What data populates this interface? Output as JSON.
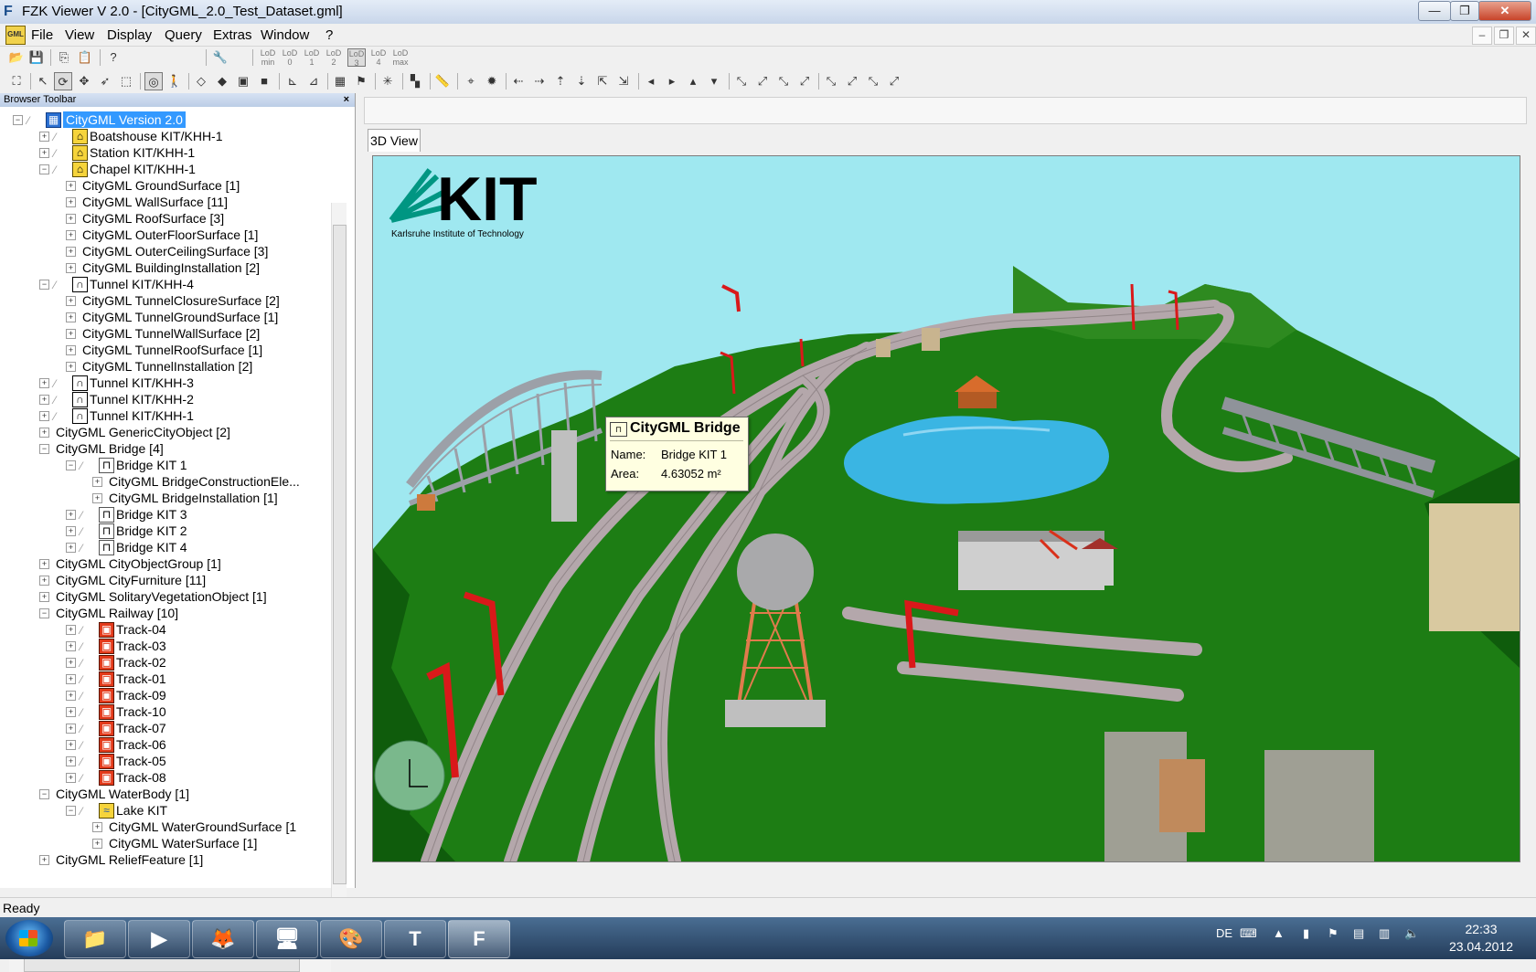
{
  "window": {
    "title": "FZK Viewer V 2.0 - [CityGML_2.0_Test_Dataset.gml]",
    "icon": "fzk-icon"
  },
  "menu": {
    "app_icon_label": "GML",
    "items": [
      "File",
      "View",
      "Display",
      "Query",
      "Extras",
      "Window",
      "?"
    ]
  },
  "toolbar1": {
    "lod_buttons": [
      "LoD min",
      "LoD 0",
      "LoD 1",
      "LoD 2",
      "LoD 3",
      "LoD 4",
      "LoD max"
    ],
    "lod_selected": "LoD 3"
  },
  "browser": {
    "title": "Browser Toolbar",
    "close_label": "×",
    "tree": [
      {
        "depth": 0,
        "expander": "-",
        "check": true,
        "icon": "root",
        "label": "CityGML Version 2.0",
        "selected": true
      },
      {
        "depth": 1,
        "expander": "+",
        "check": true,
        "icon": "building",
        "label": "Boatshouse KIT/KHH-1"
      },
      {
        "depth": 1,
        "expander": "+",
        "check": true,
        "icon": "building",
        "label": "Station KIT/KHH-1"
      },
      {
        "depth": 1,
        "expander": "-",
        "check": true,
        "icon": "building",
        "label": "Chapel KIT/KHH-1"
      },
      {
        "depth": 2,
        "expander": "+",
        "check": false,
        "icon": "",
        "label": "CityGML GroundSurface [1]"
      },
      {
        "depth": 2,
        "expander": "+",
        "check": false,
        "icon": "",
        "label": "CityGML WallSurface [11]"
      },
      {
        "depth": 2,
        "expander": "+",
        "check": false,
        "icon": "",
        "label": "CityGML RoofSurface [3]"
      },
      {
        "depth": 2,
        "expander": "+",
        "check": false,
        "icon": "",
        "label": "CityGML OuterFloorSurface [1]"
      },
      {
        "depth": 2,
        "expander": "+",
        "check": false,
        "icon": "",
        "label": "CityGML OuterCeilingSurface [3]"
      },
      {
        "depth": 2,
        "expander": "+",
        "check": false,
        "icon": "",
        "label": "CityGML BuildingInstallation [2]"
      },
      {
        "depth": 1,
        "expander": "-",
        "check": true,
        "icon": "tunnel",
        "label": "Tunnel KIT/KHH-4"
      },
      {
        "depth": 2,
        "expander": "+",
        "check": false,
        "icon": "",
        "label": "CityGML TunnelClosureSurface [2]"
      },
      {
        "depth": 2,
        "expander": "+",
        "check": false,
        "icon": "",
        "label": "CityGML TunnelGroundSurface [1]"
      },
      {
        "depth": 2,
        "expander": "+",
        "check": false,
        "icon": "",
        "label": "CityGML TunnelWallSurface [2]"
      },
      {
        "depth": 2,
        "expander": "+",
        "check": false,
        "icon": "",
        "label": "CityGML TunnelRoofSurface [1]"
      },
      {
        "depth": 2,
        "expander": "+",
        "check": false,
        "icon": "",
        "label": "CityGML TunnelInstallation [2]"
      },
      {
        "depth": 1,
        "expander": "+",
        "check": true,
        "icon": "tunnel",
        "label": "Tunnel KIT/KHH-3"
      },
      {
        "depth": 1,
        "expander": "+",
        "check": true,
        "icon": "tunnel",
        "label": "Tunnel KIT/KHH-2"
      },
      {
        "depth": 1,
        "expander": "+",
        "check": true,
        "icon": "tunnel",
        "label": "Tunnel KIT/KHH-1"
      },
      {
        "depth": 1,
        "expander": "+",
        "check": false,
        "icon": "",
        "label": "CityGML GenericCityObject [2]"
      },
      {
        "depth": 1,
        "expander": "-",
        "check": false,
        "icon": "",
        "label": "CityGML Bridge [4]"
      },
      {
        "depth": 2,
        "expander": "-",
        "check": true,
        "icon": "bridge",
        "label": "Bridge KIT 1"
      },
      {
        "depth": 3,
        "expander": "+",
        "check": false,
        "icon": "",
        "label": "CityGML BridgeConstructionEle..."
      },
      {
        "depth": 3,
        "expander": "+",
        "check": false,
        "icon": "",
        "label": "CityGML BridgeInstallation [1]"
      },
      {
        "depth": 2,
        "expander": "+",
        "check": true,
        "icon": "bridge",
        "label": "Bridge KIT 3"
      },
      {
        "depth": 2,
        "expander": "+",
        "check": true,
        "icon": "bridge",
        "label": "Bridge KIT 2"
      },
      {
        "depth": 2,
        "expander": "+",
        "check": true,
        "icon": "bridge",
        "label": "Bridge KIT 4"
      },
      {
        "depth": 1,
        "expander": "+",
        "check": false,
        "icon": "",
        "label": "CityGML CityObjectGroup [1]"
      },
      {
        "depth": 1,
        "expander": "+",
        "check": false,
        "icon": "",
        "label": "CityGML CityFurniture [11]"
      },
      {
        "depth": 1,
        "expander": "+",
        "check": false,
        "icon": "",
        "label": "CityGML SolitaryVegetationObject [1]"
      },
      {
        "depth": 1,
        "expander": "-",
        "check": false,
        "icon": "",
        "label": "CityGML Railway [10]"
      },
      {
        "depth": 2,
        "expander": "+",
        "check": true,
        "icon": "railway",
        "label": "Track-04"
      },
      {
        "depth": 2,
        "expander": "+",
        "check": true,
        "icon": "railway",
        "label": "Track-03"
      },
      {
        "depth": 2,
        "expander": "+",
        "check": true,
        "icon": "railway",
        "label": "Track-02"
      },
      {
        "depth": 2,
        "expander": "+",
        "check": true,
        "icon": "railway",
        "label": "Track-01"
      },
      {
        "depth": 2,
        "expander": "+",
        "check": true,
        "icon": "railway",
        "label": "Track-09"
      },
      {
        "depth": 2,
        "expander": "+",
        "check": true,
        "icon": "railway",
        "label": "Track-10"
      },
      {
        "depth": 2,
        "expander": "+",
        "check": true,
        "icon": "railway",
        "label": "Track-07"
      },
      {
        "depth": 2,
        "expander": "+",
        "check": true,
        "icon": "railway",
        "label": "Track-06"
      },
      {
        "depth": 2,
        "expander": "+",
        "check": true,
        "icon": "railway",
        "label": "Track-05"
      },
      {
        "depth": 2,
        "expander": "+",
        "check": true,
        "icon": "railway",
        "label": "Track-08"
      },
      {
        "depth": 1,
        "expander": "-",
        "check": false,
        "icon": "",
        "label": "CityGML WaterBody [1]"
      },
      {
        "depth": 2,
        "expander": "-",
        "check": true,
        "icon": "water",
        "label": "Lake KIT"
      },
      {
        "depth": 3,
        "expander": "+",
        "check": false,
        "icon": "",
        "label": "CityGML WaterGroundSurface [1"
      },
      {
        "depth": 3,
        "expander": "+",
        "check": false,
        "icon": "",
        "label": "CityGML WaterSurface [1]"
      },
      {
        "depth": 1,
        "expander": "+",
        "check": false,
        "icon": "",
        "label": "CityGML ReliefFeature [1]"
      }
    ]
  },
  "view": {
    "tab_label": "3D View",
    "logo": {
      "text": "KIT",
      "subtitle": "Karlsruhe Institute of Technology"
    },
    "colors": {
      "sky": "#9fe8f0",
      "terrain": "#1d7d14",
      "terrain_dark": "#0f5c0c",
      "water": "#3ab5e3",
      "rail": "#b4a7ab",
      "bridge": "#9ca0a8"
    },
    "tooltip": {
      "title": "CityGML Bridge",
      "rows": [
        {
          "key": "Name:",
          "value": "Bridge KIT 1"
        },
        {
          "key": "Area:",
          "value": "4.63052 m²"
        }
      ]
    }
  },
  "status": {
    "text": "Ready"
  },
  "taskbar": {
    "apps": [
      "explorer-icon",
      "media-player-icon",
      "firefox-icon",
      "terminal-icon",
      "paint-icon",
      "tool-icon",
      "fzk-viewer-icon"
    ],
    "app_glyphs": [
      "📁",
      "▶",
      "🦊",
      "🖥",
      "🎨",
      "T",
      "F"
    ],
    "tray": {
      "language": "DE",
      "up_arrow": "▲"
    },
    "time": "22:33",
    "date": "23.04.2012"
  }
}
